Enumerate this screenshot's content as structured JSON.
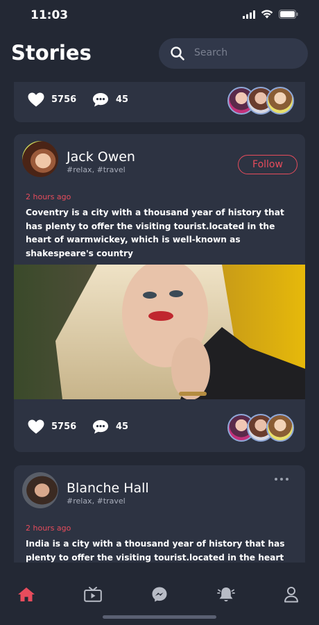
{
  "status": {
    "time": "11:03"
  },
  "header": {
    "title": "Stories",
    "search_placeholder": "Search"
  },
  "feed": {
    "first_card_partial": {
      "likes": "5756",
      "comments": "45"
    },
    "post_1": {
      "author": "Jack Owen",
      "tags": "#relax, #travel",
      "follow_label": "Follow",
      "time_ago": "2 hours ago",
      "text": "Coventry is a city with a thousand year of history that has plenty to offer the visiting tourist.located in the heart of warmwickey, which is well-known as shakespeare's country",
      "likes": "5756",
      "comments": "45"
    },
    "post_2": {
      "author": "Blanche Hall",
      "tags": "#relax, #travel",
      "time_ago": "2 hours ago",
      "text": "India is a city with a thousand year of history that has plenty to offer the visiting tourist.located in the heart"
    }
  },
  "tabbar": {
    "items": [
      "home-icon",
      "tv-icon",
      "messenger-icon",
      "bell-icon",
      "profile-icon"
    ],
    "active_index": 0
  },
  "colors": {
    "background": "#232834",
    "card": "#2d3342",
    "accent": "#e74c5c",
    "muted": "#a9aebb",
    "icon_inactive": "#b8bcc6"
  }
}
